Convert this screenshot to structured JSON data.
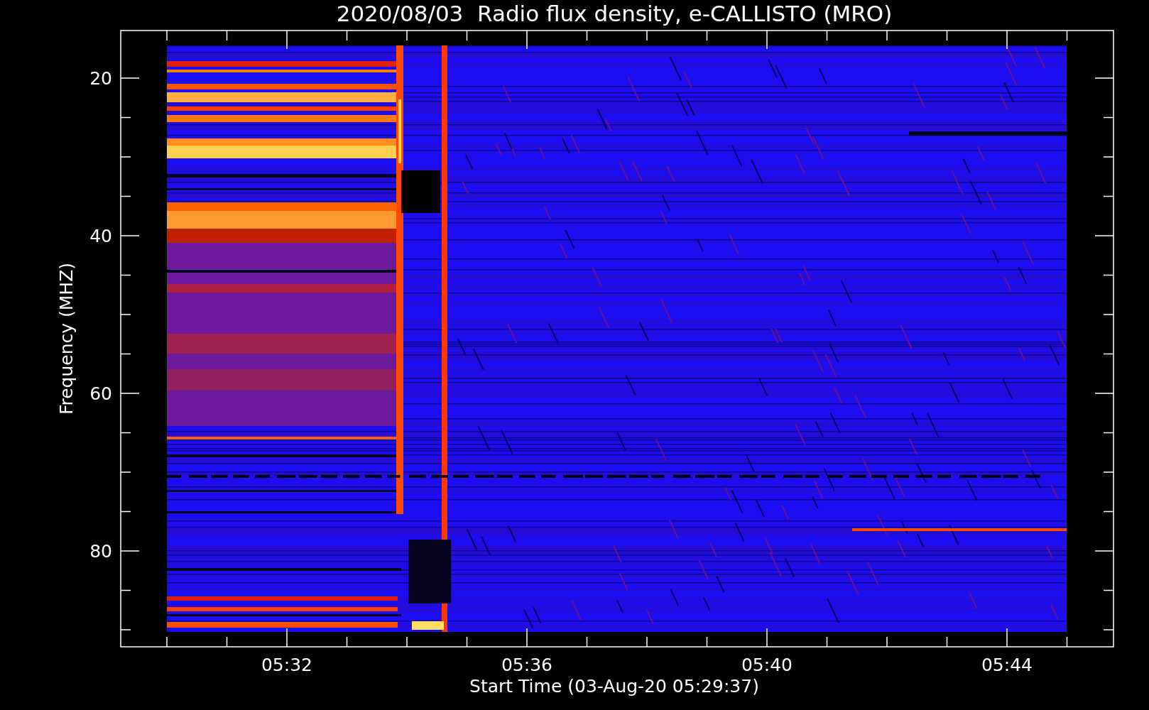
{
  "title": "2020/08/03  Radio flux density, e-CALLISTO (MRO)",
  "ylabel": "Frequency (MHZ)",
  "xlabel": "Start Time (03-Aug-20 05:29:37)",
  "yticks": [
    "20",
    "40",
    "60",
    "80"
  ],
  "xticks": [
    "05:32",
    "05:36",
    "05:40",
    "05:44"
  ]
}
